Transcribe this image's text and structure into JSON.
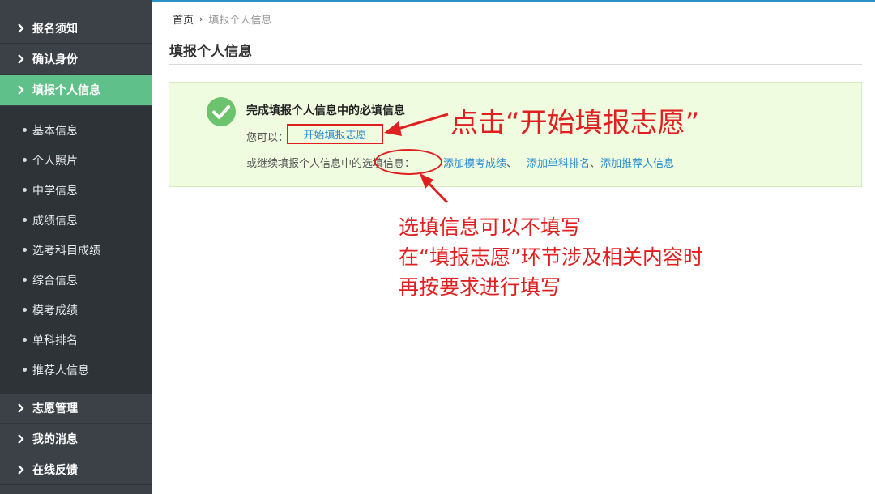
{
  "sidebar": {
    "top_items": [
      {
        "label": "报名须知"
      },
      {
        "label": "确认身份"
      },
      {
        "label": "填报个人信息"
      }
    ],
    "sub_items": [
      {
        "label": "基本信息"
      },
      {
        "label": "个人照片"
      },
      {
        "label": "中学信息"
      },
      {
        "label": "成绩信息"
      },
      {
        "label": "选考科目成绩"
      },
      {
        "label": "综合信息"
      },
      {
        "label": "模考成绩"
      },
      {
        "label": "单科排名"
      },
      {
        "label": "推荐人信息"
      }
    ],
    "bottom_items": [
      {
        "label": "志愿管理"
      },
      {
        "label": "我的消息"
      },
      {
        "label": "在线反馈"
      }
    ],
    "active_item": "填报个人信息"
  },
  "breadcrumb": {
    "home": "首页",
    "separator": "›",
    "current": "填报个人信息"
  },
  "page": {
    "title": "填报个人信息"
  },
  "panel": {
    "title": "完成填报个人信息中的必填信息",
    "can_label": "您可以：",
    "start_link": "开始填报志愿",
    "or_text": "或继续填报个人信息中的选填信息：",
    "links": [
      {
        "label": "添加模考成绩"
      },
      {
        "label": "添加单科排名"
      },
      {
        "label": "添加推荐人信息"
      }
    ],
    "sep1": "、",
    "sep2": "、"
  },
  "annotations": {
    "callout_1": "点击“开始填报志愿”",
    "callout_2_lines": [
      "选填信息可以不填写",
      "在“填报志愿”环节涉及相关内容时",
      "再按要求进行填写"
    ]
  },
  "colors": {
    "sidebar_bg": "#3b4147",
    "active_green": "#5fc08a",
    "panel_bg": "#f0fcdf",
    "link_blue": "#2a8ed1",
    "annotation_red": "#e02020"
  },
  "icons": {
    "chevron": "chevron-right-icon",
    "check": "check-circle-icon",
    "bullet": "bullet-dot-icon"
  }
}
